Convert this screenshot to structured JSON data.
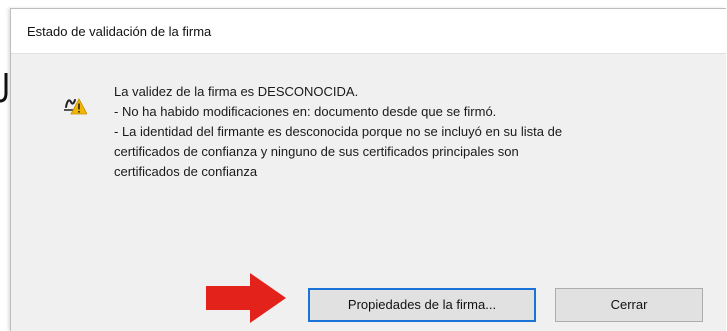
{
  "dialog": {
    "title": "Estado de validación de la firma",
    "message_lines": [
      "La validez de la firma es DESCONOCIDA.",
      "- No ha habido modificaciones en: documento desde que se firmó.",
      "- La identidad del firmante es desconocida porque no se incluyó en su lista de",
      "certificados de confianza y ninguno de sus certificados principales son",
      "certificados de confianza"
    ],
    "icon": "signature-warning-icon",
    "buttons": {
      "properties_label": "Propiedades de la firma...",
      "close_label": "Cerrar"
    },
    "annotation": {
      "icon": "red-arrow-icon",
      "color": "#e3221b"
    },
    "colors": {
      "dialog_bg": "#f0f0f0",
      "titlebar_bg": "#ffffff",
      "default_button_border": "#1a73d6",
      "warning_yellow": "#f2b705"
    }
  }
}
